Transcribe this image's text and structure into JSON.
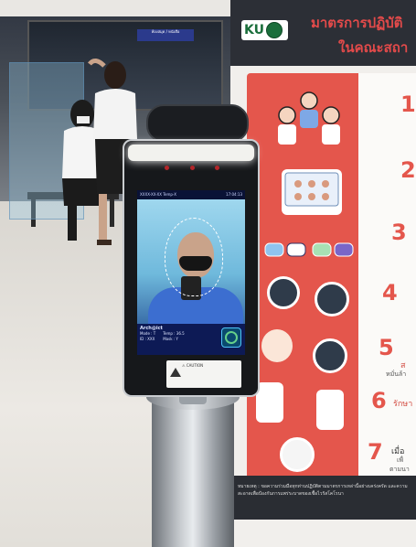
{
  "poster": {
    "logo_text": "KU",
    "title_line1": "มาตรการปฏิบัติ",
    "title_line2": "ในคณะสถา",
    "steps": [
      "1",
      "2",
      "3",
      "4",
      "5",
      "6",
      "7"
    ],
    "step_text_5a": "ส",
    "step_text_5b": "หมั่นล้า",
    "step_text_6": "รักษา",
    "step_text_7a": "เมื่อ",
    "step_text_7b": "เพื่",
    "step_text_7c": "ตามนา",
    "footer_text": "หมายเหตุ : ขอความร่วมมือทุกท่านปฏิบัติตามมาตรการเหล่านี้อย่างเคร่งครัด และความสะอาดเพื่อป้องกันการแพร่ระบาดของเชื้อไวรัสโคโรนา"
  },
  "device": {
    "screen_status_left": "XXXX-XX-XX Temp-X",
    "screen_status_right": "17:04:13",
    "info_title": "Arch@ict",
    "info_line1": "Mode : T",
    "info_line2": "Temp : 36.5",
    "info_line3": "Mask : Y",
    "info_line4": "ID : XXX",
    "label_text": "⚠ CAUTION"
  },
  "background": {
    "sign_text": "ห้องสมุด / หนังสือ"
  },
  "colors": {
    "poster_red": "#e4564c",
    "poster_dark": "#2c2f36",
    "ku_green": "#1a6e3b",
    "screen_blue": "#0d1640"
  }
}
